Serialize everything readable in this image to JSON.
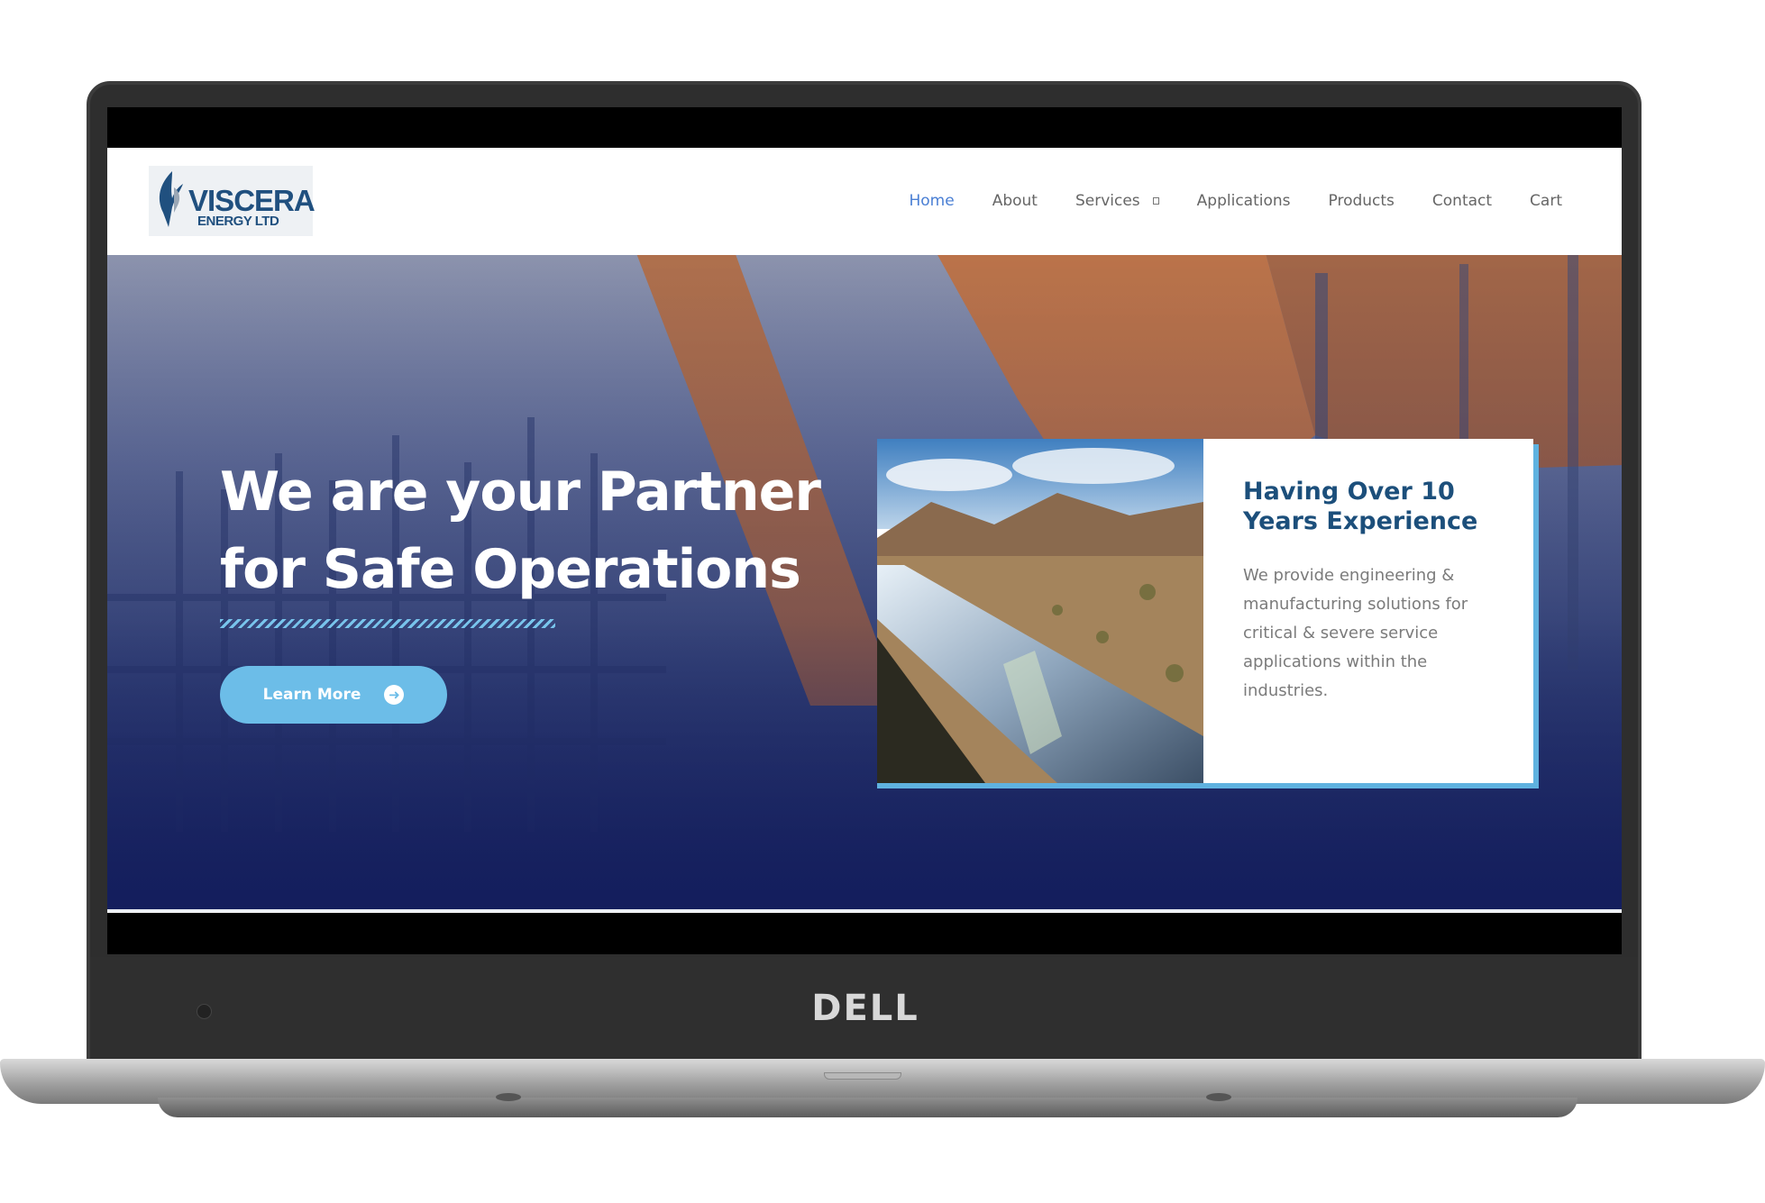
{
  "device": {
    "brand": "DELL"
  },
  "site": {
    "logo": {
      "name": "VISCERA",
      "subtitle": "ENERGY LTD"
    },
    "nav": [
      {
        "label": "Home",
        "active": true
      },
      {
        "label": "About",
        "active": false
      },
      {
        "label": "Services",
        "active": false,
        "has_dropdown": true
      },
      {
        "label": "Applications",
        "active": false
      },
      {
        "label": "Products",
        "active": false
      },
      {
        "label": "Contact",
        "active": false
      },
      {
        "label": "Cart",
        "active": false
      }
    ],
    "hero": {
      "title_line1": "We are your Partner",
      "title_line2": "for Safe Operations",
      "cta_label": "Learn More",
      "cta_icon": "arrow-right-circle-icon"
    },
    "feature": {
      "title_line1": "Having Over 10",
      "title_line2": "Years Experience",
      "text": "We provide engineering & manufacturing solutions for critical & severe service applications within the industries."
    },
    "colors": {
      "nav_active": "#4a7fd4",
      "accent": "#6cbde8",
      "heading": "#1c4f7b"
    }
  }
}
